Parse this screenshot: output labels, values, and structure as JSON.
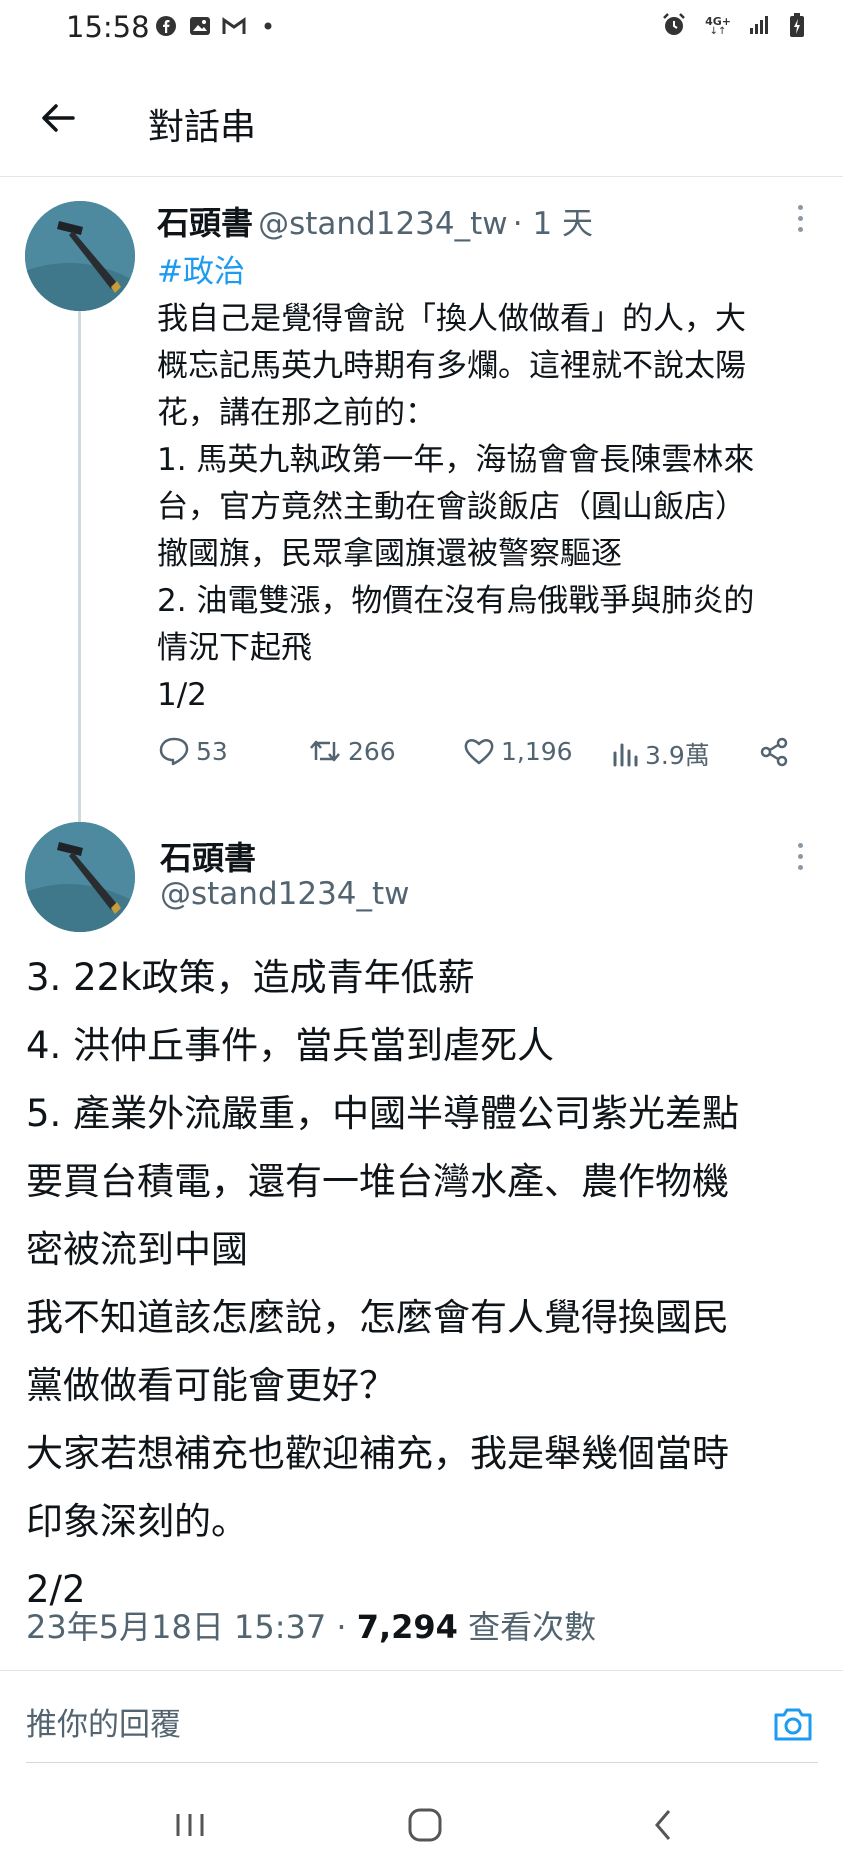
{
  "status_bar": {
    "time": "15:58",
    "network": "4G+"
  },
  "header": {
    "title": "對話串"
  },
  "tweet1": {
    "name": "石頭書",
    "handle": "@stand1234_tw",
    "time": "· 1 天",
    "hashtag": "#政治",
    "lines": [
      "我自己是覺得會說「換人做做看」的人，大",
      "概忘記馬英九時期有多爛。這裡就不說太陽",
      "花，講在那之前的：",
      "1. 馬英九執政第一年，海協會會長陳雲林來",
      "台，官方竟然主動在會談飯店（圓山飯店）",
      "撤國旗，民眾拿國旗還被警察驅逐",
      "2. 油電雙漲，物價在沒有烏俄戰爭與肺炎的",
      "情況下起飛",
      "1/2"
    ],
    "actions": {
      "replies": "53",
      "retweets": "266",
      "likes": "1,196",
      "views": "3.9萬"
    }
  },
  "tweet2": {
    "name": "石頭書",
    "handle": "@stand1234_tw",
    "lines": [
      "3. 22k政策，造成青年低薪",
      "4. 洪仲丘事件，當兵當到虐死人",
      "5. 產業外流嚴重，中國半導體公司紫光差點",
      "要買台積電，還有一堆台灣水產、農作物機",
      "密被流到中國",
      "我不知道該怎麼說，怎麼會有人覺得換國民",
      "黨做做看可能會更好？",
      "大家若想補充也歡迎補充，我是舉幾個當時",
      "印象深刻的。",
      "2/2"
    ],
    "timestamp": "23年5月18日 15:37",
    "view_count": "7,294",
    "view_label": "查看次數"
  },
  "reply": {
    "placeholder": "推你的回覆"
  },
  "colors": {
    "accent": "#1d9bf0",
    "secondary_text": "#536471",
    "text": "#0f1419"
  }
}
